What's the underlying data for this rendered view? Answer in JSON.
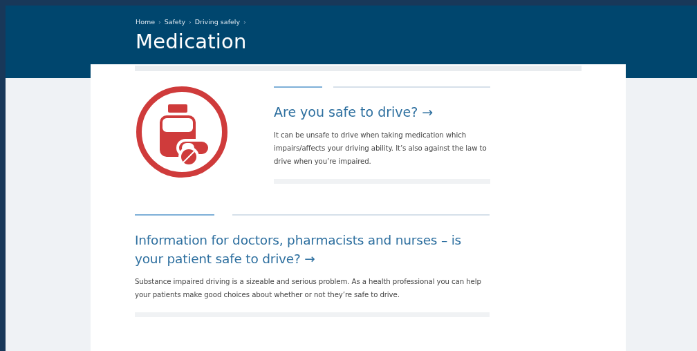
{
  "breadcrumbs": [
    {
      "label": "Home",
      "separator": "›"
    },
    {
      "label": "Safety",
      "separator": "›"
    },
    {
      "label": "Driving safely",
      "separator": "›"
    }
  ],
  "title": "Medication",
  "promos": [
    {
      "kind": "icon",
      "heading": "Are you safe to drive? →",
      "text": "It can be unsafe to drive when taking medication which impairs/affects your driving ability. It’s also against the law to drive when you’re impaired."
    },
    {
      "kind": "plain",
      "heading": "Information for doctors, pharmacists and nurses – is your patient safe to drive? →",
      "text": "Substance impaired driving is a sizeable and serious problem. As a health professional you can help your patients make good choices about whether or not they’re safe to drive."
    }
  ]
}
